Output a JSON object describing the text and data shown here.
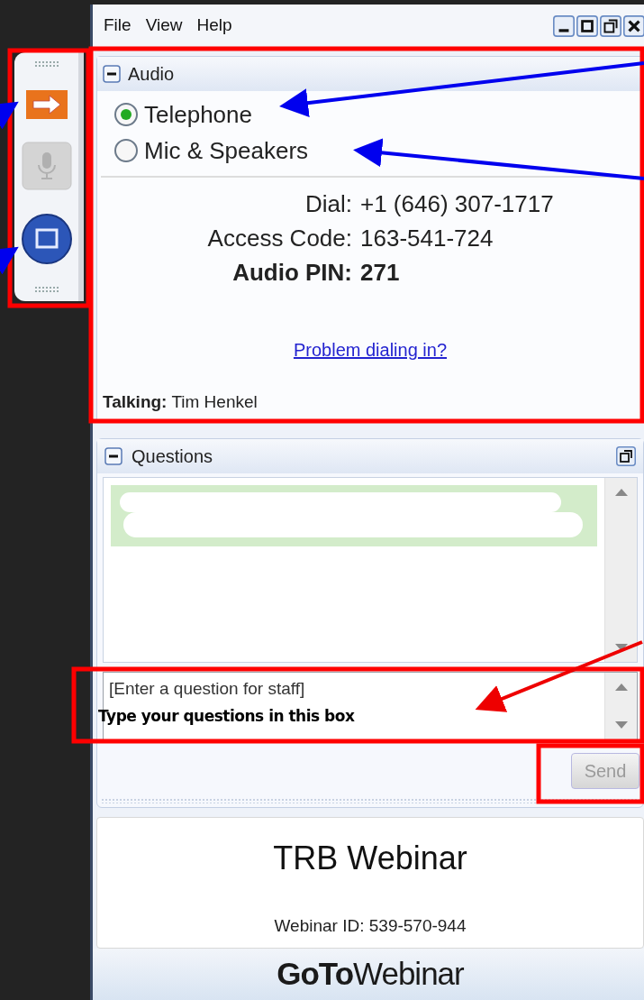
{
  "menu": [
    {
      "label": "File"
    },
    {
      "label": "View"
    },
    {
      "label": "Help"
    }
  ],
  "window_controls": [
    {
      "kind": "minimize"
    },
    {
      "kind": "maximize"
    },
    {
      "kind": "restore"
    },
    {
      "kind": "close"
    }
  ],
  "control_panel": [
    {
      "kind": "arrow",
      "disabled": false
    },
    {
      "kind": "mic",
      "disabled": true
    },
    {
      "kind": "screen",
      "disabled": false
    }
  ],
  "audio": {
    "title": "Audio",
    "expanded": true,
    "options": [
      {
        "label": "Telephone",
        "selected": true
      },
      {
        "label": "Mic & Speakers",
        "selected": false
      }
    ],
    "details": [
      {
        "label": "Dial:",
        "value": "+1 (646) 307-1717",
        "bold": false
      },
      {
        "label": "Access Code:",
        "value": "163-541-724",
        "bold": false
      },
      {
        "label": "Audio PIN:",
        "value": "271",
        "bold": true
      }
    ],
    "link": "Problem dialing in?",
    "talking_label": "Talking:",
    "talking_name": "Tim Henkel"
  },
  "questions": {
    "title": "Questions",
    "expanded": true,
    "input": {
      "placeholder": "[Enter a question for staff]"
    },
    "send": {
      "label": "Send",
      "disabled": true
    }
  },
  "webinar": {
    "title": "TRB Webinar",
    "id": "Webinar ID: 539-570-944"
  },
  "logo": {
    "bold": "GoTo",
    "light": "Webinar"
  },
  "annotation": {
    "note": "Type your questions in this box"
  }
}
